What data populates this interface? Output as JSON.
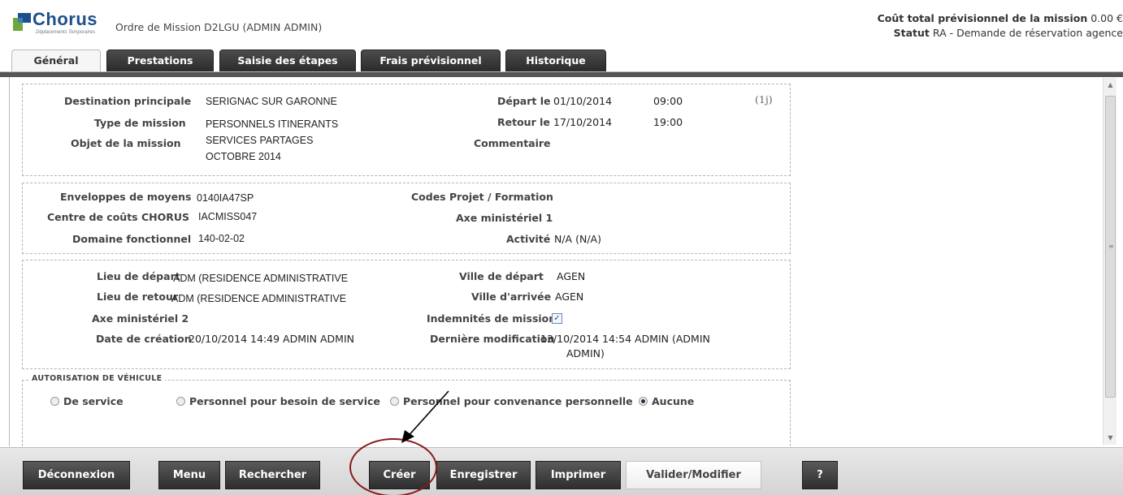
{
  "header": {
    "logo_text": "Chorus",
    "logo_subtitle": "Déplacements Temporaires",
    "title": "Ordre de Mission D2LGU (ADMIN ADMIN)",
    "cost_label": "Coût total prévisionnel de la mission",
    "cost_value": "0.00 €",
    "status_label": "Statut",
    "status_value": "RA - Demande de réservation agence"
  },
  "tabs": [
    {
      "label": "Général",
      "active": true
    },
    {
      "label": "Prestations",
      "active": false
    },
    {
      "label": "Saisie des étapes",
      "active": false
    },
    {
      "label": "Frais prévisionnel",
      "active": false
    },
    {
      "label": "Historique",
      "active": false
    }
  ],
  "section_mission": {
    "destination_label": "Destination principale",
    "destination_value": "SERIGNAC SUR GARONNE",
    "type_label": "Type de mission",
    "type_value": "PERSONNELS ITINERANTS",
    "objet_label": "Objet de la mission",
    "objet_line1": "SERVICES PARTAGES",
    "objet_line2": "OCTOBRE 2014",
    "depart_label": "Départ le",
    "depart_date": "01/10/2014",
    "depart_time": "09:00",
    "duration": "(1j)",
    "retour_label": "Retour le",
    "retour_date": "17/10/2014",
    "retour_time": "19:00",
    "commentaire_label": "Commentaire"
  },
  "section_budget": {
    "enveloppes_label": "Enveloppes de moyens",
    "enveloppes_value": "0140IA47SP",
    "centre_label": "Centre de coûts CHORUS",
    "centre_value": "IACMISS047",
    "domaine_label": "Domaine fonctionnel",
    "domaine_value": "140-02-02",
    "codes_label": "Codes Projet / Formation",
    "axe1_label": "Axe ministériel 1",
    "activite_label": "Activité",
    "activite_value": "N/A (N/A)"
  },
  "section_lieux": {
    "lieu_depart_label": "Lieu de départ",
    "lieu_depart_value": "ADM (RESIDENCE ADMINISTRATIVE",
    "lieu_retour_label": "Lieu de retour",
    "lieu_retour_value": "ADM (RESIDENCE ADMINISTRATIVE",
    "axe2_label": "Axe ministériel 2",
    "creation_label": "Date de création",
    "creation_value": "20/10/2014 14:49 ADMIN ADMIN",
    "ville_depart_label": "Ville de départ",
    "ville_depart_value": "AGEN",
    "ville_arrivee_label": "Ville d'arrivée",
    "ville_arrivee_value": "AGEN",
    "indemnites_label": "Indemnités de mission",
    "indemnites_checked": true,
    "modif_label": "Dernière modification",
    "modif_line1": "13/10/2014 14:54 ADMIN (ADMIN",
    "modif_line2": "ADMIN)"
  },
  "vehicule": {
    "legend": "AUTORISATION DE VÉHICULE",
    "options": [
      {
        "label": "De service",
        "selected": false
      },
      {
        "label": "Personnel pour besoin de service",
        "selected": false
      },
      {
        "label": "Personnel pour convenance personnelle",
        "selected": false
      },
      {
        "label": "Aucune",
        "selected": true
      }
    ]
  },
  "footer": {
    "deconnexion": "Déconnexion",
    "menu": "Menu",
    "rechercher": "Rechercher",
    "creer": "Créer",
    "enregistrer": "Enregistrer",
    "imprimer": "Imprimer",
    "valider": "Valider/Modifier",
    "help": "?"
  },
  "colors": {
    "brand_blue": "#1d4f8c",
    "annotation_red": "#8b1a1a",
    "button_dark": "#3a3a3a"
  }
}
